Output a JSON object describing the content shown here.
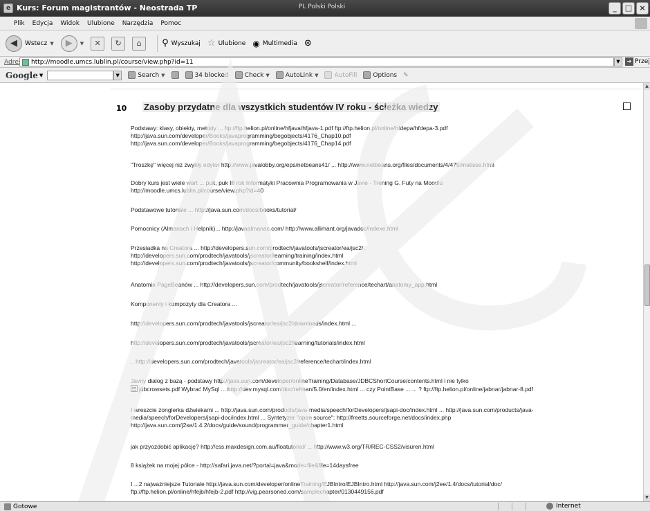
{
  "window": {
    "title": "Kurs: Forum magistrantów - Neostrada TP",
    "lang_indicator": "PL Polski   Polski"
  },
  "menu": [
    "Plik",
    "Edycja",
    "Widok",
    "Ulubione",
    "Narzędzia",
    "Pomoc"
  ],
  "toolbar": {
    "back": "Wstecz",
    "search": "Wyszukaj",
    "favorites": "Ulubione",
    "multimedia": "Multimedia"
  },
  "address": {
    "label": "Adres",
    "url": "http://moodle.umcs.lublin.pl/course/view.php?id=11",
    "go": "Przejdź"
  },
  "googlebar": {
    "logo": "Google",
    "search": "Search",
    "blocked": "34 blocked",
    "check": "Check",
    "autolink": "AutoLink",
    "autofill": "AutoFill",
    "options": "Options"
  },
  "section": {
    "number": "10",
    "title": "Zasoby przydatne dla wszystkich studentów IV roku - ścieżka wiedzy"
  },
  "entries": [
    {
      "lines": [
        "Podstawy: klasy, obiekty, metody ... ftp://ftp.helion.pl/online/hfjava/hfjava-1.pdf  ftp://ftp.helion.pl/online/hfdepa/hfdepa-3.pdf",
        " http://java.sun.com/developer/Books/javaprogramming/begobjects/4176_Chap10.pdf",
        "http://java.sun.com/developer/Books/javaprogramming/begobjects/4176_Chap14.pdf"
      ]
    },
    {
      "lines": [
        "\"Troszkę\" więcej niz zwykły edytor http://www.javalobby.org/eps/netbeans41/ ...  http://www.netbeans.org/files/documents/4/475/matisse.html"
      ]
    },
    {
      "lines": [
        "Dobry kurs jest wiele wart ... puk, puk III rok Informatyki Pracownia Programowania w Javie - Trening G. Futy na Moodlu",
        "http://moodle.umcs.lublin.pl/course/view.php?id=40"
      ]
    },
    {
      "lines": [
        "Podstawowe tutoriale ... http://java.sun.com/docs/books/tutorial/"
      ]
    },
    {
      "lines": [
        "Pomocnicy (Almanach i Helpnik)... http://javaalmanac.com/  http://www.allimant.org/javadoc/indexe.html"
      ]
    },
    {
      "lines": [
        "Przesiadka na Creatora  ... http://developers.sun.com/prodtech/javatools/jscreator/ea/jsc2/,",
        "http://developers.sun.com/prodtech/javatools/jscreator/learning/training/index.html",
        "http://developers.sun.com/prodtech/javatools/jscreator/community/bookshelf/index.html"
      ]
    },
    {
      "lines": [
        "Anatomia PageBeanów ... http://developers.sun.com/prodtech/javatools/jscreator/reference/techart/anatomy_app.html"
      ]
    },
    {
      "lines": [
        "Komponenty i kompozyty dla Creatora ..."
      ]
    },
    {
      "lines": [
        "http://developers.sun.com/prodtech/javatools/jscreator/ea/jsc2/downloads/index.html ..."
      ]
    },
    {
      "lines": [
        "http://developers.sun.com/prodtech/javatools/jscreator/ea/jsc2/learning/tutorials/index.html"
      ]
    },
    {
      "lines": [
        ".. http://developers.sun.com/prodtech/javatools/jscreator/ea/jsc2/reference/techart/index.html"
      ]
    },
    {
      "lines": [
        "Javny dialog z bazą - podstawy http://java.sun.com/developer/onlineTraining/Database/JDBCShortCourse/contents.html  i nie tylko",
        "jdbcrowsets.pdf  Wybrać MySql ... http://dev.mysql.com/doc/refman/5.0/en/index.html ... czy PointBase ... ... ?   ftp://ftp.helion.pl/online/jabnar/jabnar-8.pdf"
      ]
    },
    {
      "lines": [
        "I wreszcie żonglerka dźwiekami  ... http://java.sun.com/products/java-media/speech/forDevelopers/jsapi-doc/index.html  ... http://java.sun.com/products/java-",
        "media/speech/forDevelopers/jsapi-doc/index.html  ... Syntetyzer  \"open source\": http://freetts.sourceforge.net/docs/index.php",
        "http://java.sun.com/j2se/1.4.2/docs/guide/sound/programmer_guide/chapter1.html"
      ]
    },
    {
      "lines": [
        "jak przyozdobić aplikację? http://css.maxdesign.com.au/floatutorial/  ...  http://www.w3.org/TR/REC-CSS2/visuren.html"
      ]
    },
    {
      "lines": [
        "8 książek na mojej półce - http://safari.java.net/?portal=java&mode=file&file=14daysfree"
      ]
    },
    {
      "lines": [
        "I ...2 najważniejsze Tutoriale http://java.sun.com/developer/onlineTraining/EJBIntro/EJBIntro.html   http://java.sun.com/j2ee/1.4/docs/tutorial/doc/",
        "ftp://ftp.helion.pl/online/hfejb/hfejb-2.pdf  http://vig.pearsoned.com/samplechapter/0130449156.pdf"
      ]
    }
  ],
  "status": {
    "left": "Gotowe",
    "zone": "Internet"
  },
  "colors": {
    "titlebar": "#3a3a3a",
    "watermark": "#f0f0f0"
  }
}
